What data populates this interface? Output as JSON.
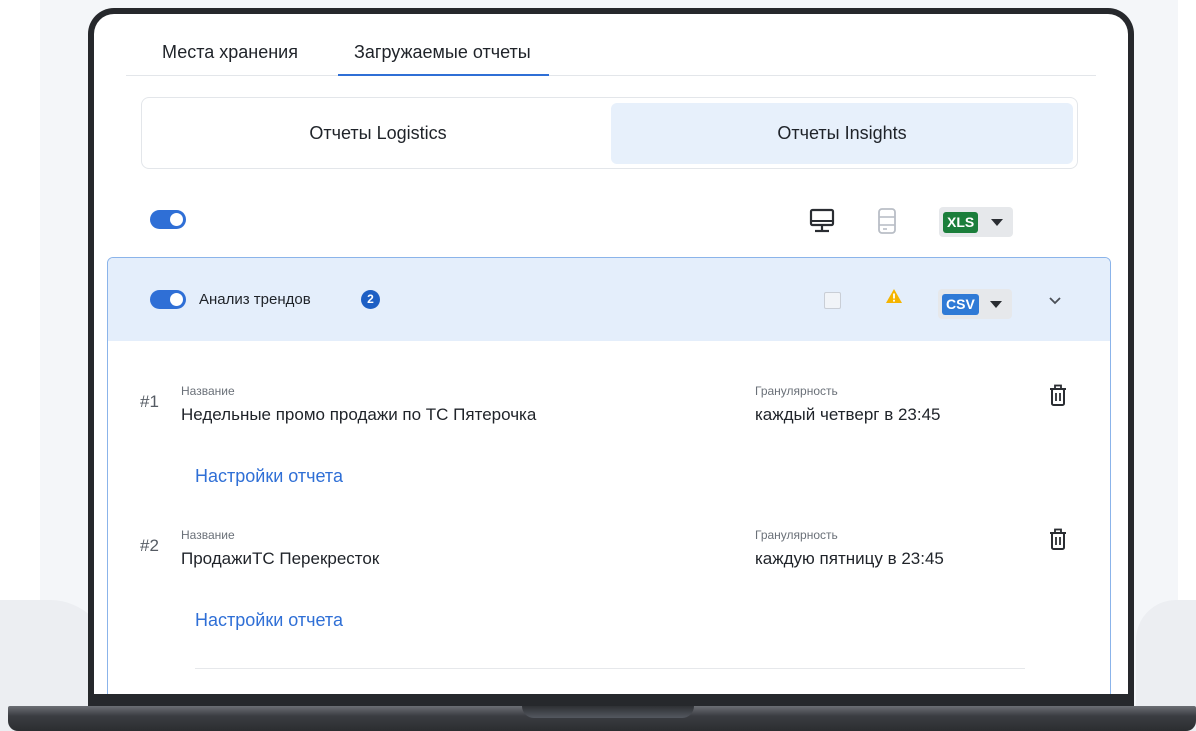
{
  "tabs": [
    {
      "label": "Места хранения",
      "active": false
    },
    {
      "label": "Загружаемые отчеты",
      "active": true
    }
  ],
  "segments": [
    {
      "label": "Отчеты Logistics",
      "active": false
    },
    {
      "label": "Отчеты Insights",
      "active": true
    }
  ],
  "toolbar": {
    "master_toggle_on": true,
    "format": "XLS",
    "format_color": "#1b7e3b"
  },
  "group": {
    "title": "Анализ трендов",
    "count": "2",
    "toggle_on": true,
    "format": "CSV",
    "format_color": "#2f7ad6",
    "accent": "#2f6fd6"
  },
  "reports": [
    {
      "number": "#1",
      "name_label": "Название",
      "name": "Недельные промо продажи по ТС Пятерочка",
      "granularity_label": "Гранулярность",
      "granularity": "каждый четверг в 23:45",
      "settings_label": "Настройки отчета"
    },
    {
      "number": "#2",
      "name_label": "Название",
      "name": "ПродажиТС Перекресток",
      "granularity_label": "Гранулярность",
      "granularity": "каждую пятницу в 23:45",
      "settings_label": "Настройки отчета"
    }
  ],
  "icons": {
    "monitor": "monitor-icon",
    "database": "database-icon",
    "warning": "warning-icon",
    "chevron": "chevron-down-icon",
    "trash": "trash-icon"
  }
}
